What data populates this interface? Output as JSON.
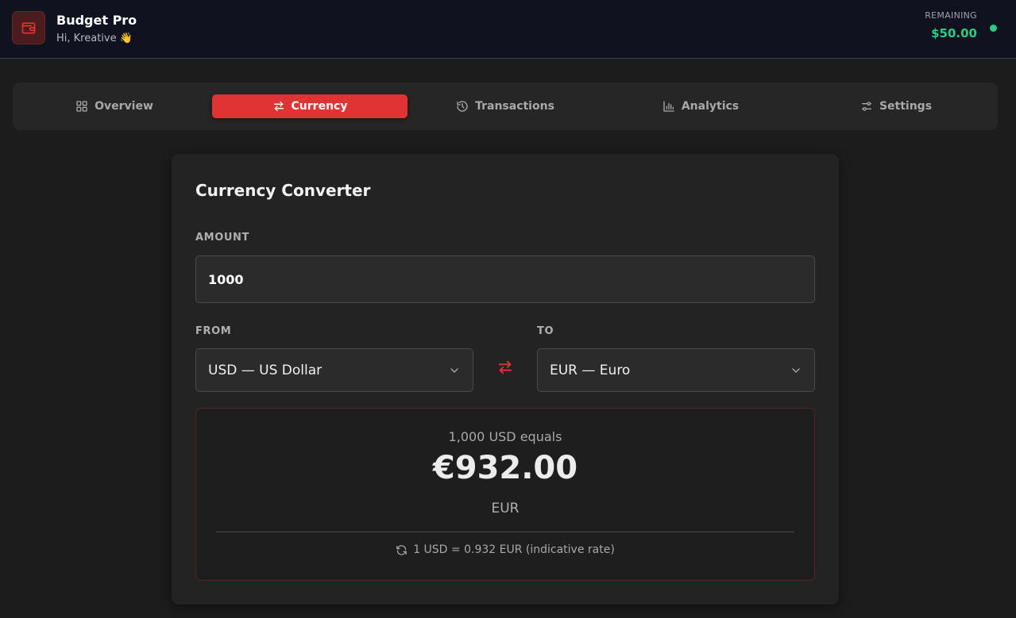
{
  "header": {
    "app_title": "Budget Pro",
    "greeting": "Hi, Kreative 👋",
    "remaining_label": "REMAINING",
    "remaining_value": "$50.00",
    "logo_icon": "wallet-icon",
    "status_color": "#2ecc83"
  },
  "tabs": [
    {
      "label": "Overview",
      "icon": "grid-icon",
      "active": false
    },
    {
      "label": "Currency",
      "icon": "swap-arrows-icon",
      "active": true
    },
    {
      "label": "Transactions",
      "icon": "history-icon",
      "active": false
    },
    {
      "label": "Analytics",
      "icon": "bar-chart-icon",
      "active": false
    },
    {
      "label": "Settings",
      "icon": "sliders-icon",
      "active": false
    }
  ],
  "converter": {
    "title": "Currency Converter",
    "amount_label": "AMOUNT",
    "amount_value": "1000",
    "from_label": "FROM",
    "from_value": "USD — US Dollar",
    "to_label": "TO",
    "to_value": "EUR — Euro",
    "result_caption": "1,000 USD equals",
    "result_value": "€932.00",
    "result_unit": "EUR",
    "rate_text": "1 USD = 0.932 EUR (indicative rate)"
  },
  "colors": {
    "accent": "#e03434",
    "positive": "#2ecc83",
    "background": "#1c1c1c"
  }
}
